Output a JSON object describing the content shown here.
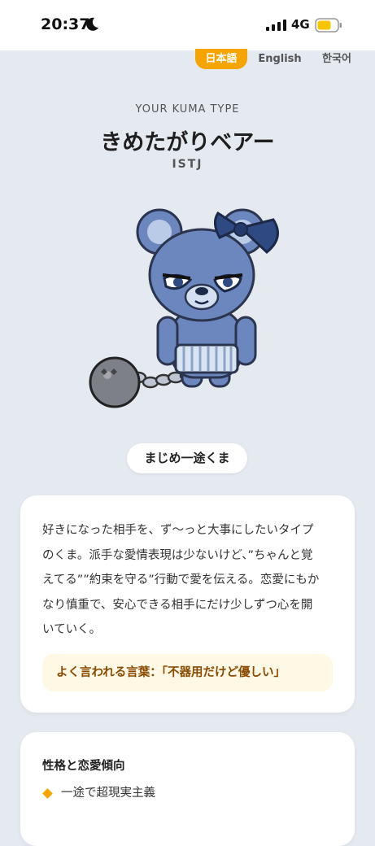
{
  "status_bar": {
    "time": "20:37",
    "network": "4G"
  },
  "languages": [
    "日本語",
    "English",
    "한국어"
  ],
  "result": {
    "caption": "YOUR KUMA TYPE",
    "name": "きめたがりベアー",
    "code": "ISTJ",
    "nickname": "まじめ一途くま"
  },
  "description": {
    "lines": [
      "好きになった相手を、ず〜っと大事にしたいタイプ",
      "のくま。派手な愛情表現は少ないけど、”ちゃんと覚",
      "えてる””約束を守る”行動で愛を伝える。恋愛にもか",
      "なり慎重で、安心できる相手にだけ少しずつ心を開",
      "いていく。"
    ],
    "quote": "よく言われる言葉：「不器用だけど優しい」"
  },
  "traits": {
    "title": "性格と恋愛傾向",
    "items": [
      "一途で超現実主義"
    ]
  },
  "colors": {
    "accent": "#f5a400",
    "background": "#e5e9f0",
    "bear": "#6b87bd"
  }
}
